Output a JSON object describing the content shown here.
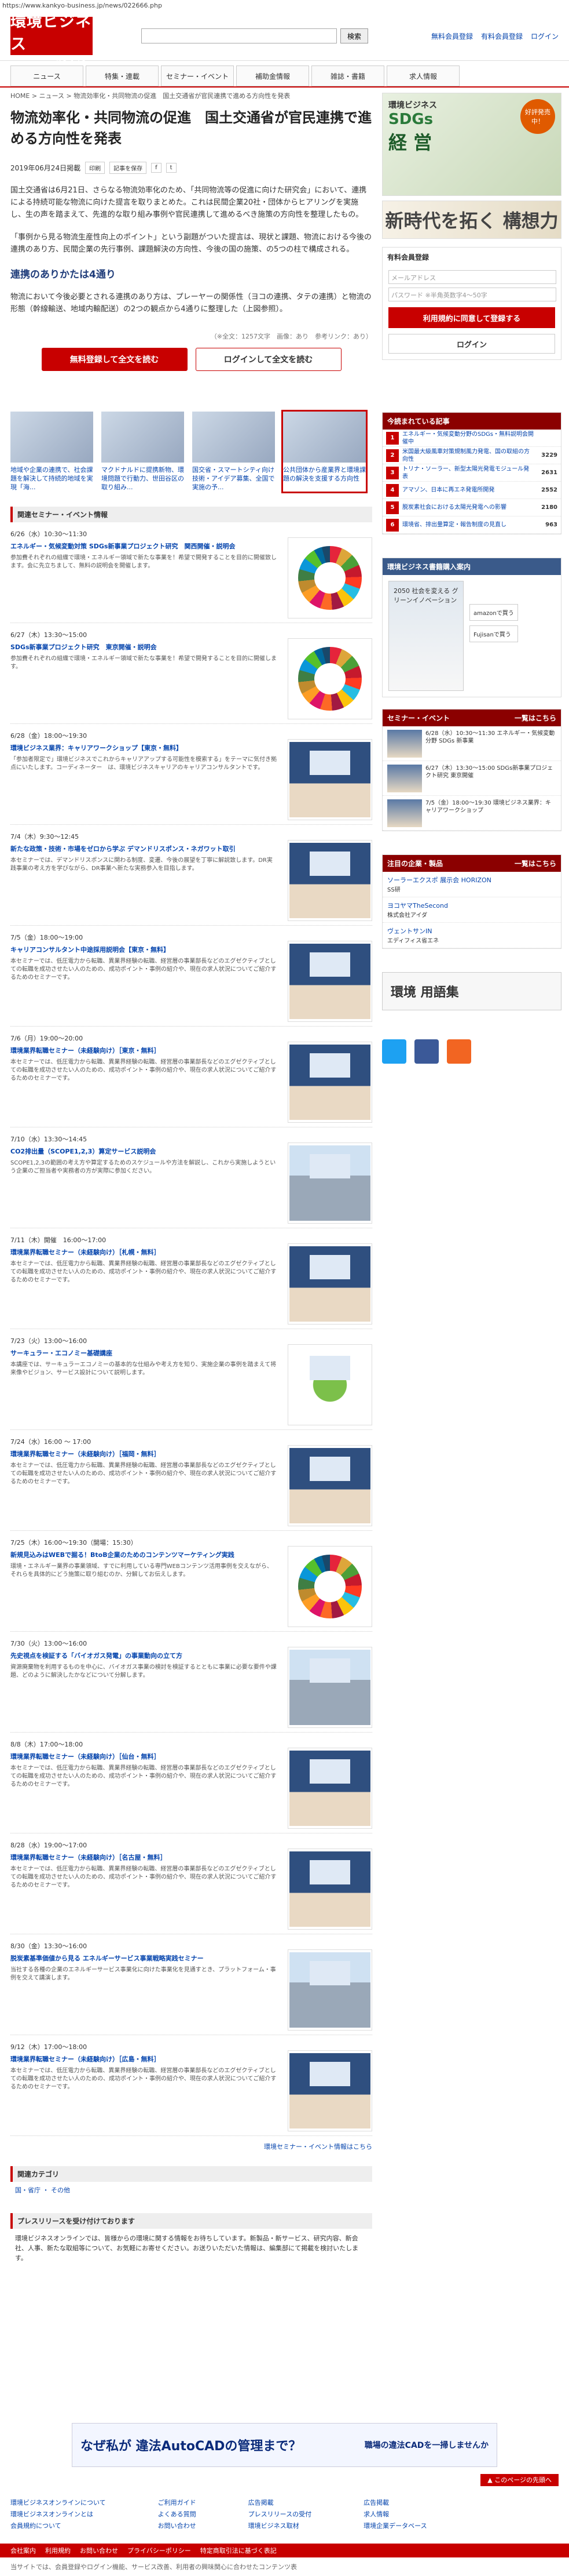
{
  "url": "https://www.kankyo-business.jp/news/022666.php",
  "header": {
    "logo1": "環境ビジネス",
    "logo2": "オンライン",
    "search_btn": "検索",
    "links": [
      "無料会員登録",
      "有料会員登録",
      "ログイン"
    ]
  },
  "nav": [
    "ニュース",
    "特集・連載",
    "セミナー・イベント",
    "補助金情報",
    "雑誌・書籍",
    "求人情報"
  ],
  "breadcrumb": "HOME > ニュース > 物流効率化・共同物流の促進　国土交通省が官民連携で進める方向性を発表",
  "article": {
    "title": "物流効率化・共同物流の促進　国土交通省が官民連携で進める方向性を発表",
    "date": "2019年06月24日掲載",
    "btn_print": "印刷",
    "btn_mail": "記事を保存",
    "p1": "国土交通省は6月21日、さらなる物流効率化のため、「共同物流等の促進に向けた研究会」において、連携による持続可能な物流に向けた提言を取りまとめた。これは民間企業20社・団体からヒアリングを実施し、生の声を踏まえて、先進的な取り組み事例や官民連携して進めるべき施策の方向性を整理したもの。",
    "p2": "「事例から見る物流生産性向上のポイント」という副題がついた提言は、現状と課題、物流における今後の連携のあり方、民間企業の先行事例、課題解決の方向性、今後の国の施策、の5つの柱で構成される。",
    "h2": "連携のありかたは4通り",
    "p3": "物流において今後必要とされる連携のあり方は、プレーヤーの関係性（ヨコの連携、タテの連携）と物流の形態（幹線輸送、地域内輸配送）の2つの観点から4通りに整理した（上図参照）。",
    "meta": "（※全文：1257文字　画像：あり　参考リンク：あり）",
    "btn_read": "無料登録して全文を読む",
    "btn_login": "ログインして全文を読む"
  },
  "related": [
    {
      "label": "地域や企業の連携で、社会課題を解決して持続的地域を実現「海..."
    },
    {
      "label": "マクドナルドに提携新物、環境問題で行動力、世田谷区の取り組み..."
    },
    {
      "label": "国交省・スマートシティ向け技術・アイデア募集、全国で実施の予..."
    },
    {
      "label": "公共団体から産業界と環境課題の解決を支援する方向性"
    }
  ],
  "events_title": "関連セミナー・イベント情報",
  "events": [
    {
      "date": "6/26（水）10:30〜11:30",
      "title": "エネルギー・気候変動対策 SDGs新事業プロジェクト研究　関西開催・説明会",
      "text": "参加費それぞれの組織で環境・エネルギー領域で新たな事業を！希望で開発することを目的に開催致します。会に先立ちまして、無料の説明会を開催します。",
      "pic": "sdg"
    },
    {
      "date": "6/27（木）13:30〜15:00",
      "title": "SDGs新事業プロジェクト研究　東京開催・説明会",
      "text": "参加費それぞれの組織で環境・エネルギー領域で新たな事業を！希望で開発することを目的に開催します。",
      "pic": "sdg"
    },
    {
      "date": "6/28（金）18:00〜19:30",
      "title": "環境ビジネス業界：キャリアワークショップ【東京・無料】",
      "text": "「参加者限定で」環境ビジネスでこれからキャリアアップする可能性を模索する」をテーマに気付き拠点にいたします。コーディネーター　は、環境ビジネスキャリアのキャリアコンサルタントです。",
      "pic": "sem"
    },
    {
      "date": "7/4（木）9:30〜12:45",
      "title": "新たな政策・技術・市場をゼロから学ぶ デマンドリスポンス・ネガワット取引",
      "text": "本セミナーでは、デマンドリスポンスに関わる制度、変遷、今後の展望を丁寧に解説致します。DR実践事業の考え方を学びながら、DR事業へ新たな実務参入を目指します。",
      "pic": "sem"
    },
    {
      "date": "7/5（金）18:00〜19:00",
      "title": "キャリアコンサルタント中途採用説明会【東京・無料】",
      "text": "本セミナーでは、低圧電力から転職、異業界経験の転職、経営層の事業部長などのエグゼクティブとしての転職を成功させたい人のための、成功ポイント・事例の紹介や、現在の求人状況についてご紹介するためのセミナーです。",
      "pic": "sem"
    },
    {
      "date": "7/6（月）19:00〜20:00",
      "title": "環境業界転職セミナー（未経験向け）［東京・無料］",
      "text": "本セミナーでは、低圧電力から転職、異業界経験の転職、経営層の事業部長などのエグゼクティブとしての転職を成功させたい人のための、成功ポイント・事例の紹介や、現在の求人状況についてご紹介するためのセミナーです。",
      "pic": "sem"
    },
    {
      "date": "7/10（水）13:30〜14:45",
      "title": "CO2排出量（SCOPE1,2,3）算定サービス説明会",
      "text": "SCOPE1,2,3の範囲の考え方や算定するためのスケジュールや方法を解説し、これから実施しようという企業のご担当者や実務者の方が実際に参加ください。",
      "pic": "city"
    },
    {
      "date": "7/11（木）開催　16:00〜17:00",
      "title": "環境業界転職セミナー（未経験向け）［札幌・無料］",
      "text": "本セミナーでは、低圧電力から転職、異業界経験の転職、経営層の事業部長などのエグゼクティブとしての転職を成功させたい人のための、成功ポイント・事例の紹介や、現在の求人状況についてご紹介するためのセミナーです。",
      "pic": "sem"
    },
    {
      "date": "7/23（火）13:00〜16:00",
      "title": "サーキュラー・エコノミー基礎講座",
      "text": "本講座では、サーキュラーエコノミーの基本的な仕組みや考え方を知り、実施企業の事例を踏まえて将来像やビジョン、サービス設計について説明します。",
      "pic": "leaf"
    },
    {
      "date": "7/24（水）16:00 〜 17:00",
      "title": "環境業界転職セミナー（未経験向け）［福岡・無料］",
      "text": "本セミナーでは、低圧電力から転職、異業界経験の転職、経営層の事業部長などのエグゼクティブとしての転職を成功させたい人のための、成功ポイント・事例の紹介や、現在の求人状況についてご紹介するためのセミナーです。",
      "pic": "sem"
    },
    {
      "date": "7/25（木）16:00〜19:30（開場：15:30）",
      "title": "新規見込みはWEBで掘る！BtoB企業のためのコンテンツマーケティング実践",
      "text": "環境・エネルギー業界の事業領域、すでに利用している専門WEBコンテンツ活用事例を交えながら、それらを具体的にどう施策に取り組むのか、分解してお伝えします。",
      "pic": "sdg"
    },
    {
      "date": "7/30（火）13:00〜16:00",
      "title": "先史視点を検証する「バイオガス発電」の事業動向の立て方",
      "text": "資源廃棄物を利用するものを中心に、バイオガス事業の検討を検証するとともに事業に必要な要件や課題、どのように解決したかなどについて分解します。",
      "pic": "city"
    },
    {
      "date": "8/8（木）17:00〜18:00",
      "title": "環境業界転職セミナー（未経験向け）［仙台・無料］",
      "text": "本セミナーでは、低圧電力から転職、異業界経験の転職、経営層の事業部長などのエグゼクティブとしての転職を成功させたい人のための、成功ポイント・事例の紹介や、現在の求人状況についてご紹介するためのセミナーです。",
      "pic": "sem"
    },
    {
      "date": "8/28（水）19:00〜17:00",
      "title": "環境業界転職セミナー（未経験向け）［名古屋・無料］",
      "text": "本セミナーでは、低圧電力から転職、異業界経験の転職、経営層の事業部長などのエグゼクティブとしての転職を成功させたい人のための、成功ポイント・事例の紹介や、現在の求人状況についてご紹介するためのセミナーです。",
      "pic": "sem"
    },
    {
      "date": "8/30（金）13:30〜16:00",
      "title": "脱炭素基準価値から見る エネルギーサービス事業戦略実践セミナー",
      "text": "当社する各種の企業のエネルギーサービス事業化に向けた事業化を見通すとき、プラットフォーム・事例を交えて講演します。",
      "pic": "city"
    },
    {
      "date": "9/12（木）17:00〜18:00",
      "title": "環境業界転職セミナー（未経験向け）［広島・無料］",
      "text": "本セミナーでは、低圧電力から転職、異業界経験の転職、経営層の事業部長などのエグゼクティブとしての転職を成功させたい人のための、成功ポイント・事例の紹介や、現在の求人状況についてご紹介するためのセミナーです。",
      "pic": "sem"
    }
  ],
  "events_more": "環境セミナー・イベント情報はこちら",
  "category_title": "関連カテゴリ",
  "category": "国・省庁 ・ その他",
  "press_title": "プレスリリースを受け付けております",
  "press_text": "環境ビジネスオンラインでは、皆様からの環境に関する情報をお待ちしています。新製品・新サービス、研究内容、新会社、人事、新たな取組等について、お気軽にお寄せください。お送りいただいた情報は、編集部にて掲載を検討いたします。",
  "side": {
    "ad_title": "環境ビジネス",
    "ad_k": "SDGs",
    "ad_s": "経 営",
    "ad_r": "好評発売中！",
    "ad2": "新時代を拓く 構想力",
    "login_title": "有料会員登録",
    "email_ph": "メールアドレス",
    "pw_ph": "パスワード ※半角英数字4〜50字",
    "reg_btn": "利用規約に同意して登録する",
    "login_btn": "ログイン",
    "rank_title": "今読まれている記事",
    "ranks": [
      {
        "t": "エネルギー・気候変動分野のSDGs・無料説明会開催中",
        "v": ""
      },
      {
        "t": "米国最大級風車対策規制風力発電、国の取組の方向性",
        "v": "3229"
      },
      {
        "t": "トリナ・ソーラー、新型太陽光発電モジュール発表",
        "v": "2631"
      },
      {
        "t": "アマゾン、日本に再エネ発電所開発",
        "v": "2552"
      },
      {
        "t": "脱炭素社会における太陽光発電への影響",
        "v": "2180"
      },
      {
        "t": "環境省、排出量算定・報告制度の見直し",
        "v": "963"
      }
    ],
    "book_title": "環境ビジネス書籍購入案内",
    "book_btn1": "amazonで買う",
    "book_btn2": "Fujisanで買う",
    "book_text": "2050 社会を変える グリーンイノベーション",
    "sem_title": "セミナー・イベント",
    "sem_more": "一覧はこちら",
    "sems": [
      "6/28（水）10:30〜11:30 エネルギー・気候変動分野 SDGs 新事業",
      "6/27（木）13:30〜15:00 SDGs新事業プロジェクト研究 東京開催",
      "7/5（金）18:00〜19:30 環境ビジネス業界：キャリアワークショップ"
    ],
    "kw_title": "注目の企業・製品",
    "kw_more": "一覧はこちら",
    "kws": [
      {
        "t": "ソーラーエクスポ 展示会 HORIZON",
        "s": "SS研"
      },
      {
        "t": "ヨコヤマTheSecond",
        "s": "株式会社アイダ"
      },
      {
        "t": "ヴェントサンIN",
        "s": "エディフィス省エネ"
      }
    ],
    "glossary": "環境 用語集"
  },
  "footer": {
    "ad": "なぜ私が 違法AutoCADの管理まで？",
    "ad2": "職場の違法CADを一掃しませんか",
    "pagetop": "▲ このページの先頭へ",
    "cols": [
      [
        "環境ビジネスオンラインについて",
        "環境ビジネスオンラインとは",
        "会員規約について"
      ],
      [
        "ご利用ガイド",
        "よくある質問",
        "お問い合わせ"
      ],
      [
        "広告掲載",
        "プレスリリースの受付",
        "環境ビジネス取材"
      ],
      [
        "広告掲載",
        "求人情報",
        "環境企業データベース"
      ]
    ],
    "bar": [
      "会社案内",
      "利用規約",
      "お問い合わせ",
      "プライバシーポリシー",
      "特定商取引法に基づく表記"
    ],
    "note": "当サイトでは、会員登録やログイン機能、サービス改善、利用者の興味関心に合わせたコンテンツ表"
  },
  "colors": {
    "accent": "#c80000",
    "link": "#0645ad",
    "panel": "#8b0000"
  }
}
